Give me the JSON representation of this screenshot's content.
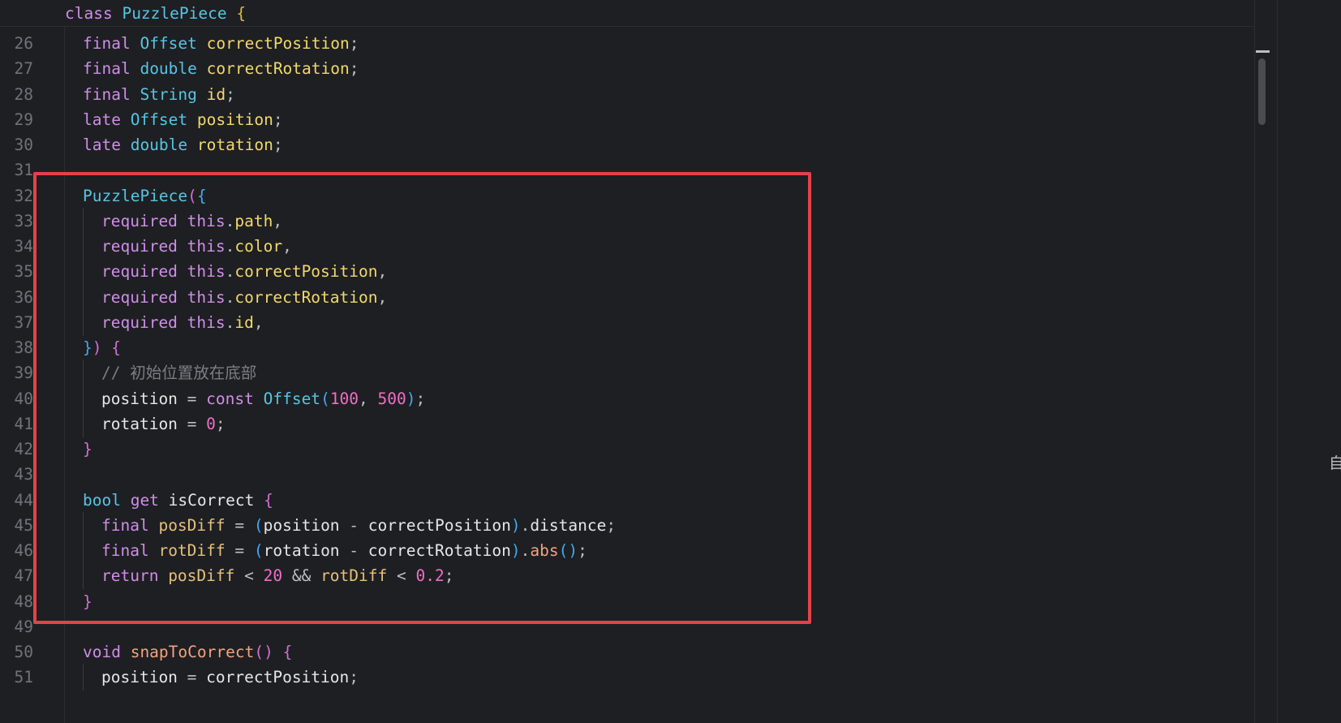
{
  "sticky_header": {
    "line": [
      {
        "t": "class ",
        "c": "kw"
      },
      {
        "t": "PuzzlePiece",
        "c": "ty"
      },
      {
        "t": " ",
        "c": "pn"
      },
      {
        "t": "{",
        "c": "br1"
      }
    ]
  },
  "right_panel": {
    "truncated_char": "自"
  },
  "lines": [
    {
      "n": "26",
      "indent": 1,
      "tokens": [
        {
          "t": "final ",
          "c": "kw"
        },
        {
          "t": "Offset ",
          "c": "ty"
        },
        {
          "t": "correctPosition",
          "c": "fld"
        },
        {
          "t": ";",
          "c": "pn"
        }
      ]
    },
    {
      "n": "27",
      "indent": 1,
      "tokens": [
        {
          "t": "final ",
          "c": "kw"
        },
        {
          "t": "double ",
          "c": "ty"
        },
        {
          "t": "correctRotation",
          "c": "fld"
        },
        {
          "t": ";",
          "c": "pn"
        }
      ]
    },
    {
      "n": "28",
      "indent": 1,
      "tokens": [
        {
          "t": "final ",
          "c": "kw"
        },
        {
          "t": "String ",
          "c": "ty"
        },
        {
          "t": "id",
          "c": "fld"
        },
        {
          "t": ";",
          "c": "pn"
        }
      ]
    },
    {
      "n": "29",
      "indent": 1,
      "tokens": [
        {
          "t": "late ",
          "c": "kw"
        },
        {
          "t": "Offset ",
          "c": "ty"
        },
        {
          "t": "position",
          "c": "fld"
        },
        {
          "t": ";",
          "c": "pn"
        }
      ]
    },
    {
      "n": "30",
      "indent": 1,
      "tokens": [
        {
          "t": "late ",
          "c": "kw"
        },
        {
          "t": "double ",
          "c": "ty"
        },
        {
          "t": "rotation",
          "c": "fld"
        },
        {
          "t": ";",
          "c": "pn"
        }
      ]
    },
    {
      "n": "31",
      "indent": 1,
      "tokens": []
    },
    {
      "n": "32",
      "indent": 1,
      "tokens": [
        {
          "t": "PuzzlePiece",
          "c": "ty"
        },
        {
          "t": "(",
          "c": "br2"
        },
        {
          "t": "{",
          "c": "br3"
        }
      ]
    },
    {
      "n": "33",
      "indent": 2,
      "tokens": [
        {
          "t": "required ",
          "c": "kw"
        },
        {
          "t": "this",
          "c": "kw"
        },
        {
          "t": ".",
          "c": "pn"
        },
        {
          "t": "path",
          "c": "fld"
        },
        {
          "t": ",",
          "c": "pn"
        }
      ]
    },
    {
      "n": "34",
      "indent": 2,
      "tokens": [
        {
          "t": "required ",
          "c": "kw"
        },
        {
          "t": "this",
          "c": "kw"
        },
        {
          "t": ".",
          "c": "pn"
        },
        {
          "t": "color",
          "c": "fld"
        },
        {
          "t": ",",
          "c": "pn"
        }
      ]
    },
    {
      "n": "35",
      "indent": 2,
      "tokens": [
        {
          "t": "required ",
          "c": "kw"
        },
        {
          "t": "this",
          "c": "kw"
        },
        {
          "t": ".",
          "c": "pn"
        },
        {
          "t": "correctPosition",
          "c": "fld"
        },
        {
          "t": ",",
          "c": "pn"
        }
      ]
    },
    {
      "n": "36",
      "indent": 2,
      "tokens": [
        {
          "t": "required ",
          "c": "kw"
        },
        {
          "t": "this",
          "c": "kw"
        },
        {
          "t": ".",
          "c": "pn"
        },
        {
          "t": "correctRotation",
          "c": "fld"
        },
        {
          "t": ",",
          "c": "pn"
        }
      ]
    },
    {
      "n": "37",
      "indent": 2,
      "tokens": [
        {
          "t": "required ",
          "c": "kw"
        },
        {
          "t": "this",
          "c": "kw"
        },
        {
          "t": ".",
          "c": "pn"
        },
        {
          "t": "id",
          "c": "fld"
        },
        {
          "t": ",",
          "c": "pn"
        }
      ]
    },
    {
      "n": "38",
      "indent": 1,
      "tokens": [
        {
          "t": "}",
          "c": "br3"
        },
        {
          "t": ")",
          "c": "br2"
        },
        {
          "t": " ",
          "c": "pn"
        },
        {
          "t": "{",
          "c": "br2"
        }
      ]
    },
    {
      "n": "39",
      "indent": 2,
      "tokens": [
        {
          "t": "// 初始位置放在底部",
          "c": "cm"
        }
      ]
    },
    {
      "n": "40",
      "indent": 2,
      "tokens": [
        {
          "t": "position",
          "c": "id"
        },
        {
          "t": " = ",
          "c": "pn"
        },
        {
          "t": "const ",
          "c": "kw"
        },
        {
          "t": "Offset",
          "c": "ty"
        },
        {
          "t": "(",
          "c": "br3"
        },
        {
          "t": "100",
          "c": "num"
        },
        {
          "t": ", ",
          "c": "pn"
        },
        {
          "t": "500",
          "c": "num"
        },
        {
          "t": ")",
          "c": "br3"
        },
        {
          "t": ";",
          "c": "pn"
        }
      ]
    },
    {
      "n": "41",
      "indent": 2,
      "tokens": [
        {
          "t": "rotation",
          "c": "id"
        },
        {
          "t": " = ",
          "c": "pn"
        },
        {
          "t": "0",
          "c": "num"
        },
        {
          "t": ";",
          "c": "pn"
        }
      ]
    },
    {
      "n": "42",
      "indent": 1,
      "tokens": [
        {
          "t": "}",
          "c": "br2"
        }
      ]
    },
    {
      "n": "43",
      "indent": 1,
      "tokens": []
    },
    {
      "n": "44",
      "indent": 1,
      "tokens": [
        {
          "t": "bool ",
          "c": "ty"
        },
        {
          "t": "get ",
          "c": "kw"
        },
        {
          "t": "isCorrect",
          "c": "id"
        },
        {
          "t": " ",
          "c": "pn"
        },
        {
          "t": "{",
          "c": "br2"
        }
      ]
    },
    {
      "n": "45",
      "indent": 2,
      "tokens": [
        {
          "t": "final ",
          "c": "kw"
        },
        {
          "t": "posDiff",
          "c": "loc"
        },
        {
          "t": " = ",
          "c": "pn"
        },
        {
          "t": "(",
          "c": "br3"
        },
        {
          "t": "position",
          "c": "id"
        },
        {
          "t": " - ",
          "c": "pn"
        },
        {
          "t": "correctPosition",
          "c": "id"
        },
        {
          "t": ")",
          "c": "br3"
        },
        {
          "t": ".",
          "c": "pn"
        },
        {
          "t": "distance",
          "c": "id"
        },
        {
          "t": ";",
          "c": "pn"
        }
      ]
    },
    {
      "n": "46",
      "indent": 2,
      "tokens": [
        {
          "t": "final ",
          "c": "kw"
        },
        {
          "t": "rotDiff",
          "c": "loc"
        },
        {
          "t": " = ",
          "c": "pn"
        },
        {
          "t": "(",
          "c": "br3"
        },
        {
          "t": "rotation",
          "c": "id"
        },
        {
          "t": " - ",
          "c": "pn"
        },
        {
          "t": "correctRotation",
          "c": "id"
        },
        {
          "t": ")",
          "c": "br3"
        },
        {
          "t": ".",
          "c": "pn"
        },
        {
          "t": "abs",
          "c": "fn2"
        },
        {
          "t": "()",
          "c": "br3"
        },
        {
          "t": ";",
          "c": "pn"
        }
      ]
    },
    {
      "n": "47",
      "indent": 2,
      "tokens": [
        {
          "t": "return ",
          "c": "kw"
        },
        {
          "t": "posDiff",
          "c": "loc"
        },
        {
          "t": " < ",
          "c": "pn"
        },
        {
          "t": "20",
          "c": "num"
        },
        {
          "t": " && ",
          "c": "pn"
        },
        {
          "t": "rotDiff",
          "c": "loc"
        },
        {
          "t": " < ",
          "c": "pn"
        },
        {
          "t": "0.2",
          "c": "num"
        },
        {
          "t": ";",
          "c": "pn"
        }
      ]
    },
    {
      "n": "48",
      "indent": 1,
      "tokens": [
        {
          "t": "}",
          "c": "br2"
        }
      ]
    },
    {
      "n": "49",
      "indent": 1,
      "tokens": []
    },
    {
      "n": "50",
      "indent": 1,
      "tokens": [
        {
          "t": "void ",
          "c": "kw"
        },
        {
          "t": "snapToCorrect",
          "c": "fn2"
        },
        {
          "t": "()",
          "c": "br2"
        },
        {
          "t": " ",
          "c": "pn"
        },
        {
          "t": "{",
          "c": "br2"
        }
      ]
    },
    {
      "n": "51",
      "indent": 2,
      "tokens": [
        {
          "t": "position",
          "c": "id"
        },
        {
          "t": " = ",
          "c": "pn"
        },
        {
          "t": "correctPosition",
          "c": "id"
        },
        {
          "t": ";",
          "c": "pn"
        }
      ]
    }
  ]
}
